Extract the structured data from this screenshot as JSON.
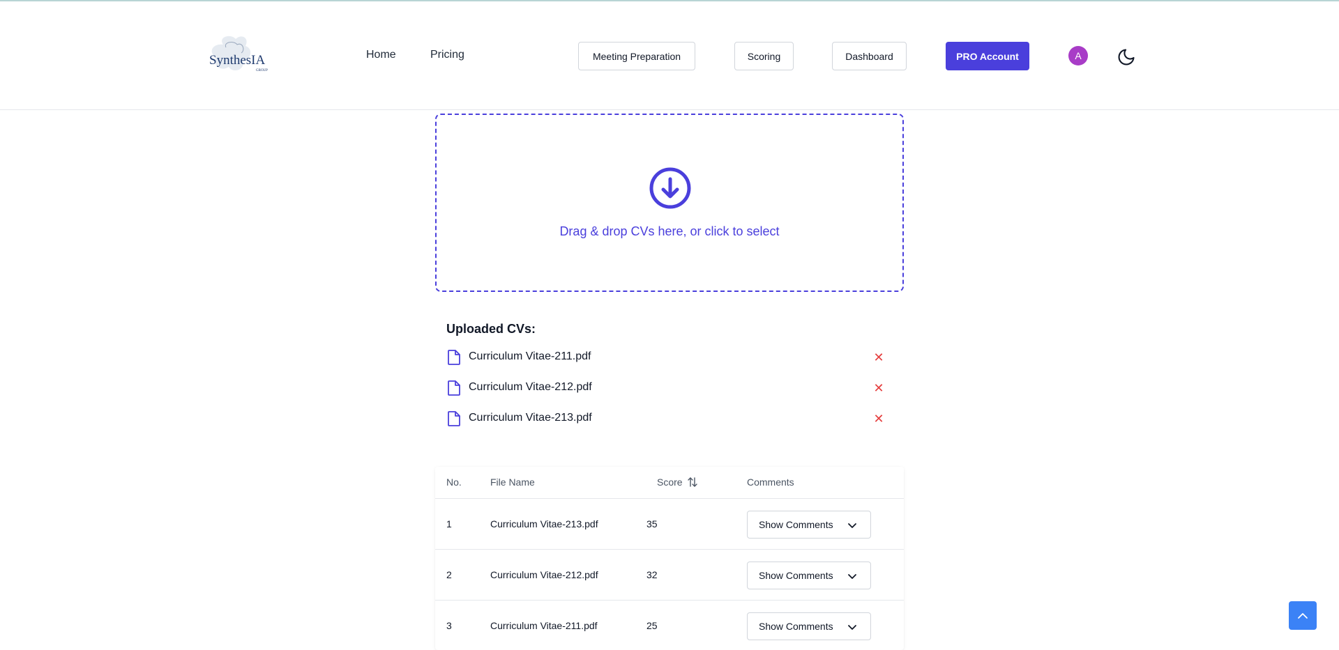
{
  "header": {
    "logo_text": "SynthesIA",
    "logo_subtext": "GROUP",
    "nav_links": [
      "Home",
      "Pricing"
    ],
    "nav_buttons": [
      "Meeting Preparation",
      "Scoring",
      "Dashboard"
    ],
    "pro_button": "PRO Account",
    "avatar_initial": "A",
    "theme_toggle_icon": "moon-icon"
  },
  "dropzone": {
    "icon": "download-circle-icon",
    "text": "Drag & drop CVs here, or click to select"
  },
  "uploaded": {
    "title": "Uploaded CVs:",
    "files": [
      "Curriculum Vitae-211.pdf",
      "Curriculum Vitae-212.pdf",
      "Curriculum Vitae-213.pdf"
    ],
    "remove_symbol": "✕"
  },
  "table": {
    "headers": {
      "no": "No.",
      "file": "File Name",
      "score": "Score",
      "comments": "Comments"
    },
    "rows": [
      {
        "no": "1",
        "file": "Curriculum Vitae-213.pdf",
        "score": "35",
        "comments_label": "Show Comments"
      },
      {
        "no": "2",
        "file": "Curriculum Vitae-212.pdf",
        "score": "32",
        "comments_label": "Show Comments"
      },
      {
        "no": "3",
        "file": "Curriculum Vitae-211.pdf",
        "score": "25",
        "comments_label": "Show Comments"
      }
    ]
  },
  "colors": {
    "accent": "#4a3fdc",
    "avatar": "#a83cc7",
    "remove": "#e53e3e",
    "scroll_top": "#3b82f6"
  }
}
